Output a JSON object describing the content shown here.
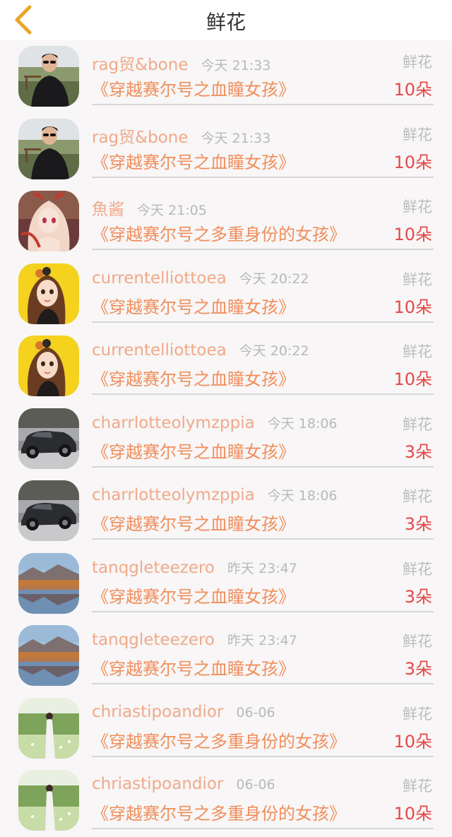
{
  "header": {
    "title": "鲜花",
    "back_icon": "chevron-left-icon",
    "accent": "#e8a72a"
  },
  "colors": {
    "name": "#f0a98a",
    "time": "#b9b9b9",
    "book": "#ef8e5c",
    "count": "#e24a4a"
  },
  "records": [
    {
      "user": "rag贸&bone",
      "time": "今天 21:33",
      "type": "鲜花",
      "book": "《穿越赛尔号之血瞳女孩》",
      "count": "10朵",
      "avatar": "avatar-man"
    },
    {
      "user": "rag贸&bone",
      "time": "今天 21:33",
      "type": "鲜花",
      "book": "《穿越赛尔号之血瞳女孩》",
      "count": "10朵",
      "avatar": "avatar-man"
    },
    {
      "user": "魚酱",
      "time": "今天 21:05",
      "type": "鲜花",
      "book": "《穿越赛尔号之多重身份的女孩》",
      "count": "10朵",
      "avatar": "avatar-anime"
    },
    {
      "user": "currentelliottoea",
      "time": "今天 20:22",
      "type": "鲜花",
      "book": "《穿越赛尔号之血瞳女孩》",
      "count": "10朵",
      "avatar": "avatar-girl"
    },
    {
      "user": "currentelliottoea",
      "time": "今天 20:22",
      "type": "鲜花",
      "book": "《穿越赛尔号之血瞳女孩》",
      "count": "10朵",
      "avatar": "avatar-girl"
    },
    {
      "user": "charrlotteolymzppia",
      "time": "今天 18:06",
      "type": "鲜花",
      "book": "《穿越赛尔号之血瞳女孩》",
      "count": "3朵",
      "avatar": "avatar-car"
    },
    {
      "user": "charrlotteolymzppia",
      "time": "今天 18:06",
      "type": "鲜花",
      "book": "《穿越赛尔号之血瞳女孩》",
      "count": "3朵",
      "avatar": "avatar-car"
    },
    {
      "user": "tanqgleteezero",
      "time": "昨天 23:47",
      "type": "鲜花",
      "book": "《穿越赛尔号之血瞳女孩》",
      "count": "3朵",
      "avatar": "avatar-lake"
    },
    {
      "user": "tanqgleteezero",
      "time": "昨天 23:47",
      "type": "鲜花",
      "book": "《穿越赛尔号之血瞳女孩》",
      "count": "3朵",
      "avatar": "avatar-lake"
    },
    {
      "user": "chriastipoandior",
      "time": "06-06",
      "type": "鲜花",
      "book": "《穿越赛尔号之多重身份的女孩》",
      "count": "10朵",
      "avatar": "avatar-field"
    },
    {
      "user": "chriastipoandior",
      "time": "06-06",
      "type": "鲜花",
      "book": "《穿越赛尔号之多重身份的女孩》",
      "count": "10朵",
      "avatar": "avatar-field"
    }
  ]
}
